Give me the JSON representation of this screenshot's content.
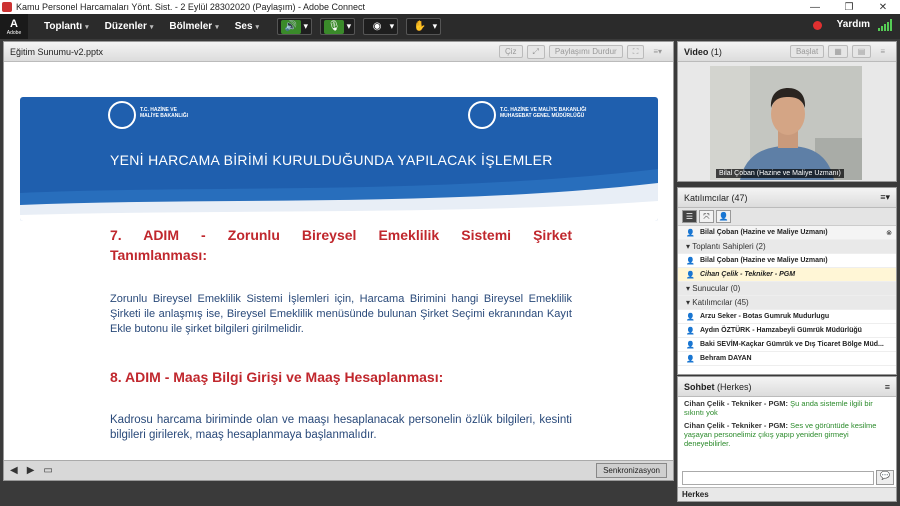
{
  "window": {
    "title": "Kamu Personel Harcamaları Yönt. Sist. - 2 Eylül 28302020 (Paylaşım) - Adobe Connect"
  },
  "menubar": {
    "logo_text": "A",
    "logo_sub": "Adobe",
    "items": [
      "Toplantı",
      "Düzenler",
      "Bölmeler",
      "Ses"
    ],
    "help": "Yardım"
  },
  "share": {
    "title": "Eğitim Sunumu-v2.pptx",
    "draw_btn": "Çiz",
    "stop_btn": "Paylaşımı Durdur",
    "sync_btn": "Senkronizasyon"
  },
  "slide": {
    "org_left": "T.C. HAZİNE VE\nMALİYE BAKANLIĞI",
    "org_right": "T.C. HAZİNE VE MALİYE BAKANLIĞI\nMUHASEBAT GENEL MÜDÜRLÜĞÜ",
    "title": "YENİ HARCAMA BİRİMİ KURULDUĞUNDA YAPILACAK İŞLEMLER",
    "step7_a": "7. ADIM - Zorunlu Bireysel Emeklilik Sistemi Şirket",
    "step7_b": "Tanımlanması:",
    "step7_text": "Zorunlu Bireysel Emeklilik Sistemi İşlemleri için, Harcama Birimini hangi Bireysel Emeklilik Şirketi ile anlaşmış ise, Bireysel Emeklilik menüsünde bulunan Şirket Seçimi ekranından Kayıt Ekle butonu ile şirket bilgileri girilmelidir.",
    "step8": "8. ADIM - Maaş Bilgi Girişi ve Maaş Hesaplanması:",
    "step8_text": "Kadrosu harcama biriminde olan ve maaşı hesaplanacak personelin özlük bilgileri, kesinti bilgileri girilerek, maaş hesaplanmaya başlanmalıdır."
  },
  "video": {
    "title": "Video",
    "count": "(1)",
    "start_btn": "Başlat",
    "person_label": "Bilal Çoban (Hazine ve Maliye Uzmanı)"
  },
  "attendees": {
    "title": "Katılımcılar",
    "count": "(47)",
    "me": "Bilal Çoban (Hazine ve Maliye Uzmanı)",
    "hosts_group": "Toplantı Sahipleri (2)",
    "hosts": [
      "Bilal Çoban (Hazine ve Maliye Uzmanı)",
      "Cihan Çelik - Tekniker - PGM"
    ],
    "presenters_group": "Sunucular (0)",
    "participants_group": "Katılımcılar (45)",
    "participants": [
      "Arzu Seker - Botas Gumruk Mudurlugu",
      "Aydın ÖZTÜRK - Hamzabeyli Gümrük Müdürlüğü",
      "Baki SEVİM-Kaçkar Gümrük ve Dış Ticaret Bölge Müd...",
      "Behram DAYAN"
    ]
  },
  "chat": {
    "title": "Sohbet",
    "scope": "(Herkes)",
    "messages": [
      {
        "sender": "Cihan Çelik - Tekniker - PGM:",
        "text": "Şu anda sistemle ilgili bir sıkıntı yok"
      },
      {
        "sender": "Cihan Çelik - Tekniker - PGM:",
        "text": "Ses ve görüntüde kesilme yaşayan personelimiz çıkış yapıp yeniden girmeyi deneyebilirler."
      }
    ],
    "footer": "Herkes"
  }
}
